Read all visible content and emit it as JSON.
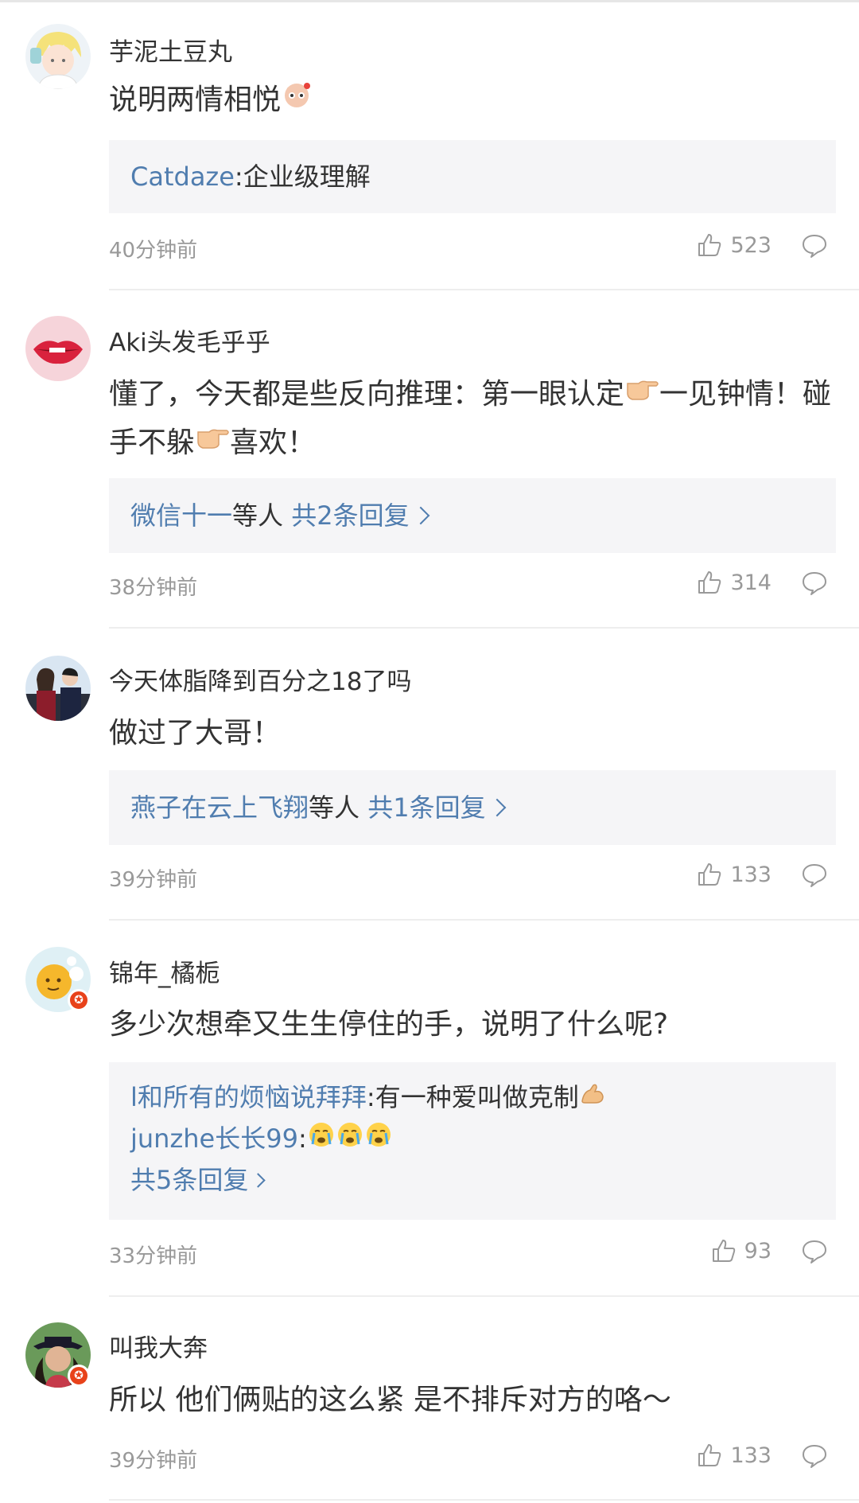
{
  "comments": [
    {
      "username": "芋泥土豆丸",
      "text": "说明两情相悦",
      "text_emoji": "cat-face-emoji",
      "reply_preview": {
        "lines": [
          {
            "author": "Catdaze",
            "text": ":企业级理解"
          }
        ]
      },
      "time": "40分钟前",
      "likes": "523",
      "avatar": "anime-boy-avatar"
    },
    {
      "username": "Aki头发毛乎乎",
      "text_parts": [
        "懂了，今天都是些反向推理：第一眼认定",
        "一见钟情！碰手不躲",
        "喜欢！"
      ],
      "inline_emoji": "pointing-right-hand-emoji",
      "reply_summary": {
        "author": "微信十一",
        "etc": "等人",
        "count_link": "共2条回复"
      },
      "time": "38分钟前",
      "likes": "314",
      "avatar": "lips-avatar"
    },
    {
      "username": "今天体脂降到百分之18了吗",
      "text": "做过了大哥！",
      "reply_summary": {
        "author": "燕子在云上飞翔",
        "etc": "等人",
        "count_link": "共1条回复"
      },
      "time": "39分钟前",
      "likes": "133",
      "avatar": "couple-photo-avatar"
    },
    {
      "username": "锦年_橘栀",
      "text": "多少次想牵又生生停住的手，说明了什么呢?",
      "reply_preview": {
        "lines": [
          {
            "author": "l和所有的烦恼说拜拜",
            "text": ":有一种爱叫做克制",
            "emoji": "flexed-biceps-emoji"
          },
          {
            "author": "junzhe长长99",
            "text": ":",
            "emoji": "crying-face-emoji x3"
          }
        ],
        "count_link": "共5条回复"
      },
      "time": "33分钟前",
      "likes": "93",
      "avatar": "orange-cartoon-avatar",
      "verified": true
    },
    {
      "username": "叫我大奔",
      "text": "所以 他们俩贴的这么紧 是不排斥对方的咯～",
      "time": "39分钟前",
      "likes": "133",
      "avatar": "woman-hat-avatar",
      "verified": true
    }
  ],
  "icons": {
    "like": "thumbs-up-icon",
    "comment": "comment-bubble-icon",
    "verified": "verified-badge-icon"
  },
  "colors": {
    "link": "#507daf",
    "text": "#333333",
    "meta": "#999999",
    "reply_bg": "#f5f5f7",
    "badge": "#e8421a"
  }
}
